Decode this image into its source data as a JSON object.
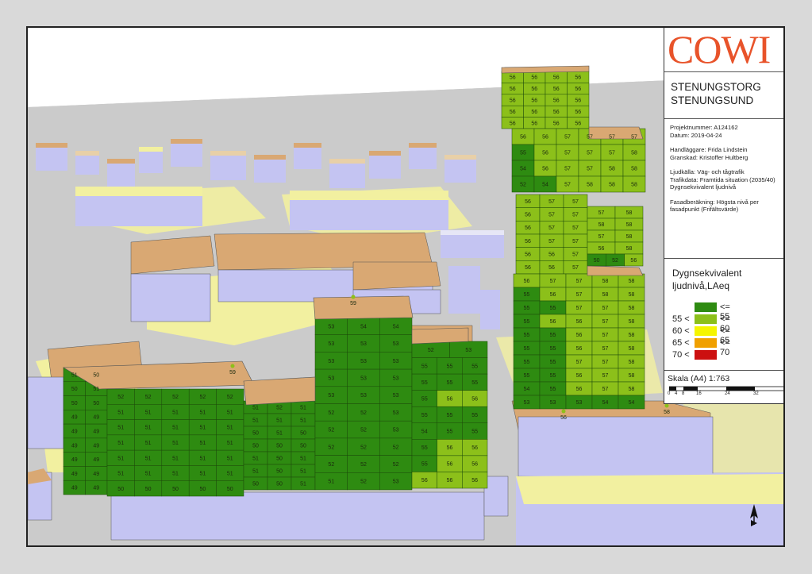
{
  "company": "COWI",
  "project": {
    "title_line1": "STENUNGSTORG",
    "title_line2": "STENUNGSUND",
    "projektnummer": "Projektnummer: A124162",
    "datum": "Datum: 2019-04-24",
    "handlaggare": "Handläggare: Frida Lindstein",
    "granskad": "Granskad: Kristoffer Hultberg",
    "ljudkalla": "Ljudkälla: Väg- och tågtrafik",
    "trafikdata": "Trafikdata: Framtida situation (2035/40)",
    "dygn": "Dygnsekvivalent ljudnivå",
    "fasad1": "Fasadberäkning: Högsta nivå per",
    "fasad2": "fasadpunkt (Frifältsvärde)"
  },
  "legend": {
    "title1": "Dygnsekvivalent",
    "title2": "ljudnivå,LAeq",
    "rows": [
      {
        "lo": "",
        "hi": "<= 55",
        "color": "#2e8b11"
      },
      {
        "lo": "55 <",
        "hi": "<= 60",
        "color": "#8cc01a"
      },
      {
        "lo": "60 <",
        "hi": "<= 65",
        "color": "#f5f500"
      },
      {
        "lo": "65 <",
        "hi": "<= 70",
        "color": "#f0a000"
      },
      {
        "lo": "70 <",
        "hi": "",
        "color": "#cc1010"
      }
    ]
  },
  "scale": {
    "label": "Skala (A4) 1:763",
    "ticks": [
      "0",
      "4",
      "8",
      "16",
      "24",
      "32"
    ]
  },
  "facade_labels": {
    "left_block_front": [
      [
        "52",
        "52",
        "52",
        "52",
        "52"
      ],
      [
        "51",
        "51",
        "51",
        "51",
        "51"
      ],
      [
        "51",
        "51",
        "51",
        "51",
        "51"
      ],
      [
        "51",
        "51",
        "51",
        "51",
        "51"
      ],
      [
        "51",
        "51",
        "51",
        "51",
        "51"
      ],
      [
        "51",
        "51",
        "51",
        "51",
        "51"
      ],
      [
        "50",
        "50",
        "50",
        "50",
        "50"
      ]
    ],
    "left_block_side": [
      [
        "51",
        "50"
      ],
      [
        "50",
        "51"
      ],
      [
        "50",
        "50"
      ],
      [
        "49",
        "49"
      ],
      [
        "49",
        "49"
      ],
      [
        "49",
        "49"
      ],
      [
        "49",
        "49"
      ],
      [
        "49",
        "49"
      ],
      [
        "49",
        "49"
      ]
    ],
    "low_block": [
      [
        "51",
        "52",
        "51"
      ],
      [
        "51",
        "51",
        "51"
      ],
      [
        "50",
        "51",
        "50"
      ],
      [
        "50",
        "50",
        "50"
      ],
      [
        "51",
        "50",
        "51"
      ],
      [
        "51",
        "50",
        "51"
      ],
      [
        "50",
        "50",
        "51"
      ]
    ],
    "mid_tower": [
      [
        "53",
        "54",
        "54"
      ],
      [
        "53",
        "53",
        "53"
      ],
      [
        "53",
        "53",
        "53"
      ],
      [
        "53",
        "53",
        "53"
      ],
      [
        "53",
        "53",
        "53"
      ],
      [
        "52",
        "52",
        "53"
      ],
      [
        "52",
        "52",
        "53"
      ],
      [
        "52",
        "52",
        "52"
      ],
      [
        "52",
        "52",
        "52"
      ],
      [
        "51",
        "52",
        "53"
      ]
    ],
    "curved_block": [
      [
        "52",
        "53"
      ],
      [
        "55",
        "55",
        "55"
      ],
      [
        "55",
        "55",
        "55"
      ],
      [
        "55",
        "56",
        "56"
      ],
      [
        "55",
        "55",
        "55"
      ],
      [
        "54",
        "55",
        "55"
      ],
      [
        "55",
        "56",
        "56"
      ],
      [
        "55",
        "56",
        "56"
      ],
      [
        "56",
        "56",
        "56"
      ]
    ],
    "tall_tower_top": [
      [
        "56",
        "56",
        "56",
        "56"
      ],
      [
        "56",
        "56",
        "56",
        "56"
      ],
      [
        "56",
        "56",
        "56",
        "56"
      ],
      [
        "56",
        "56",
        "56",
        "56"
      ],
      [
        "56",
        "56",
        "56",
        "56"
      ]
    ],
    "tall_tower_upper": [
      [
        "56",
        "56",
        "57",
        "57",
        "57",
        "57"
      ],
      [
        "55",
        "56",
        "57",
        "57",
        "57",
        "58"
      ],
      [
        "54",
        "56",
        "57",
        "57",
        "58",
        "58"
      ],
      [
        "52",
        "54",
        "57",
        "58",
        "58",
        "58"
      ]
    ],
    "tall_tower_mid": [
      [
        "56",
        "57",
        "57"
      ],
      [
        "56",
        "57",
        "57"
      ],
      [
        "56",
        "57",
        "57"
      ],
      [
        "56",
        "57",
        "57"
      ],
      [
        "56",
        "56",
        "57"
      ],
      [
        "56",
        "56",
        "57"
      ]
    ],
    "tall_tower_mid_side": [
      [
        "57",
        "58"
      ],
      [
        "58",
        "58"
      ],
      [
        "57",
        "58"
      ],
      [
        "56",
        "58"
      ],
      [
        "50",
        "52",
        "56"
      ]
    ],
    "tall_tower_lower": [
      [
        "56",
        "57",
        "57",
        "58",
        "58"
      ],
      [
        "55",
        "56",
        "57",
        "58",
        "58"
      ],
      [
        "55",
        "55",
        "57",
        "57",
        "58"
      ],
      [
        "55",
        "56",
        "56",
        "57",
        "58"
      ],
      [
        "55",
        "55",
        "56",
        "57",
        "58"
      ],
      [
        "55",
        "55",
        "56",
        "57",
        "58"
      ],
      [
        "55",
        "55",
        "57",
        "57",
        "58"
      ],
      [
        "55",
        "55",
        "56",
        "57",
        "58"
      ],
      [
        "54",
        "55",
        "56",
        "57",
        "58"
      ],
      [
        "53",
        "53",
        "53",
        "54",
        "54"
      ]
    ],
    "ground_points": [
      "56",
      "58",
      "59",
      "59"
    ]
  }
}
